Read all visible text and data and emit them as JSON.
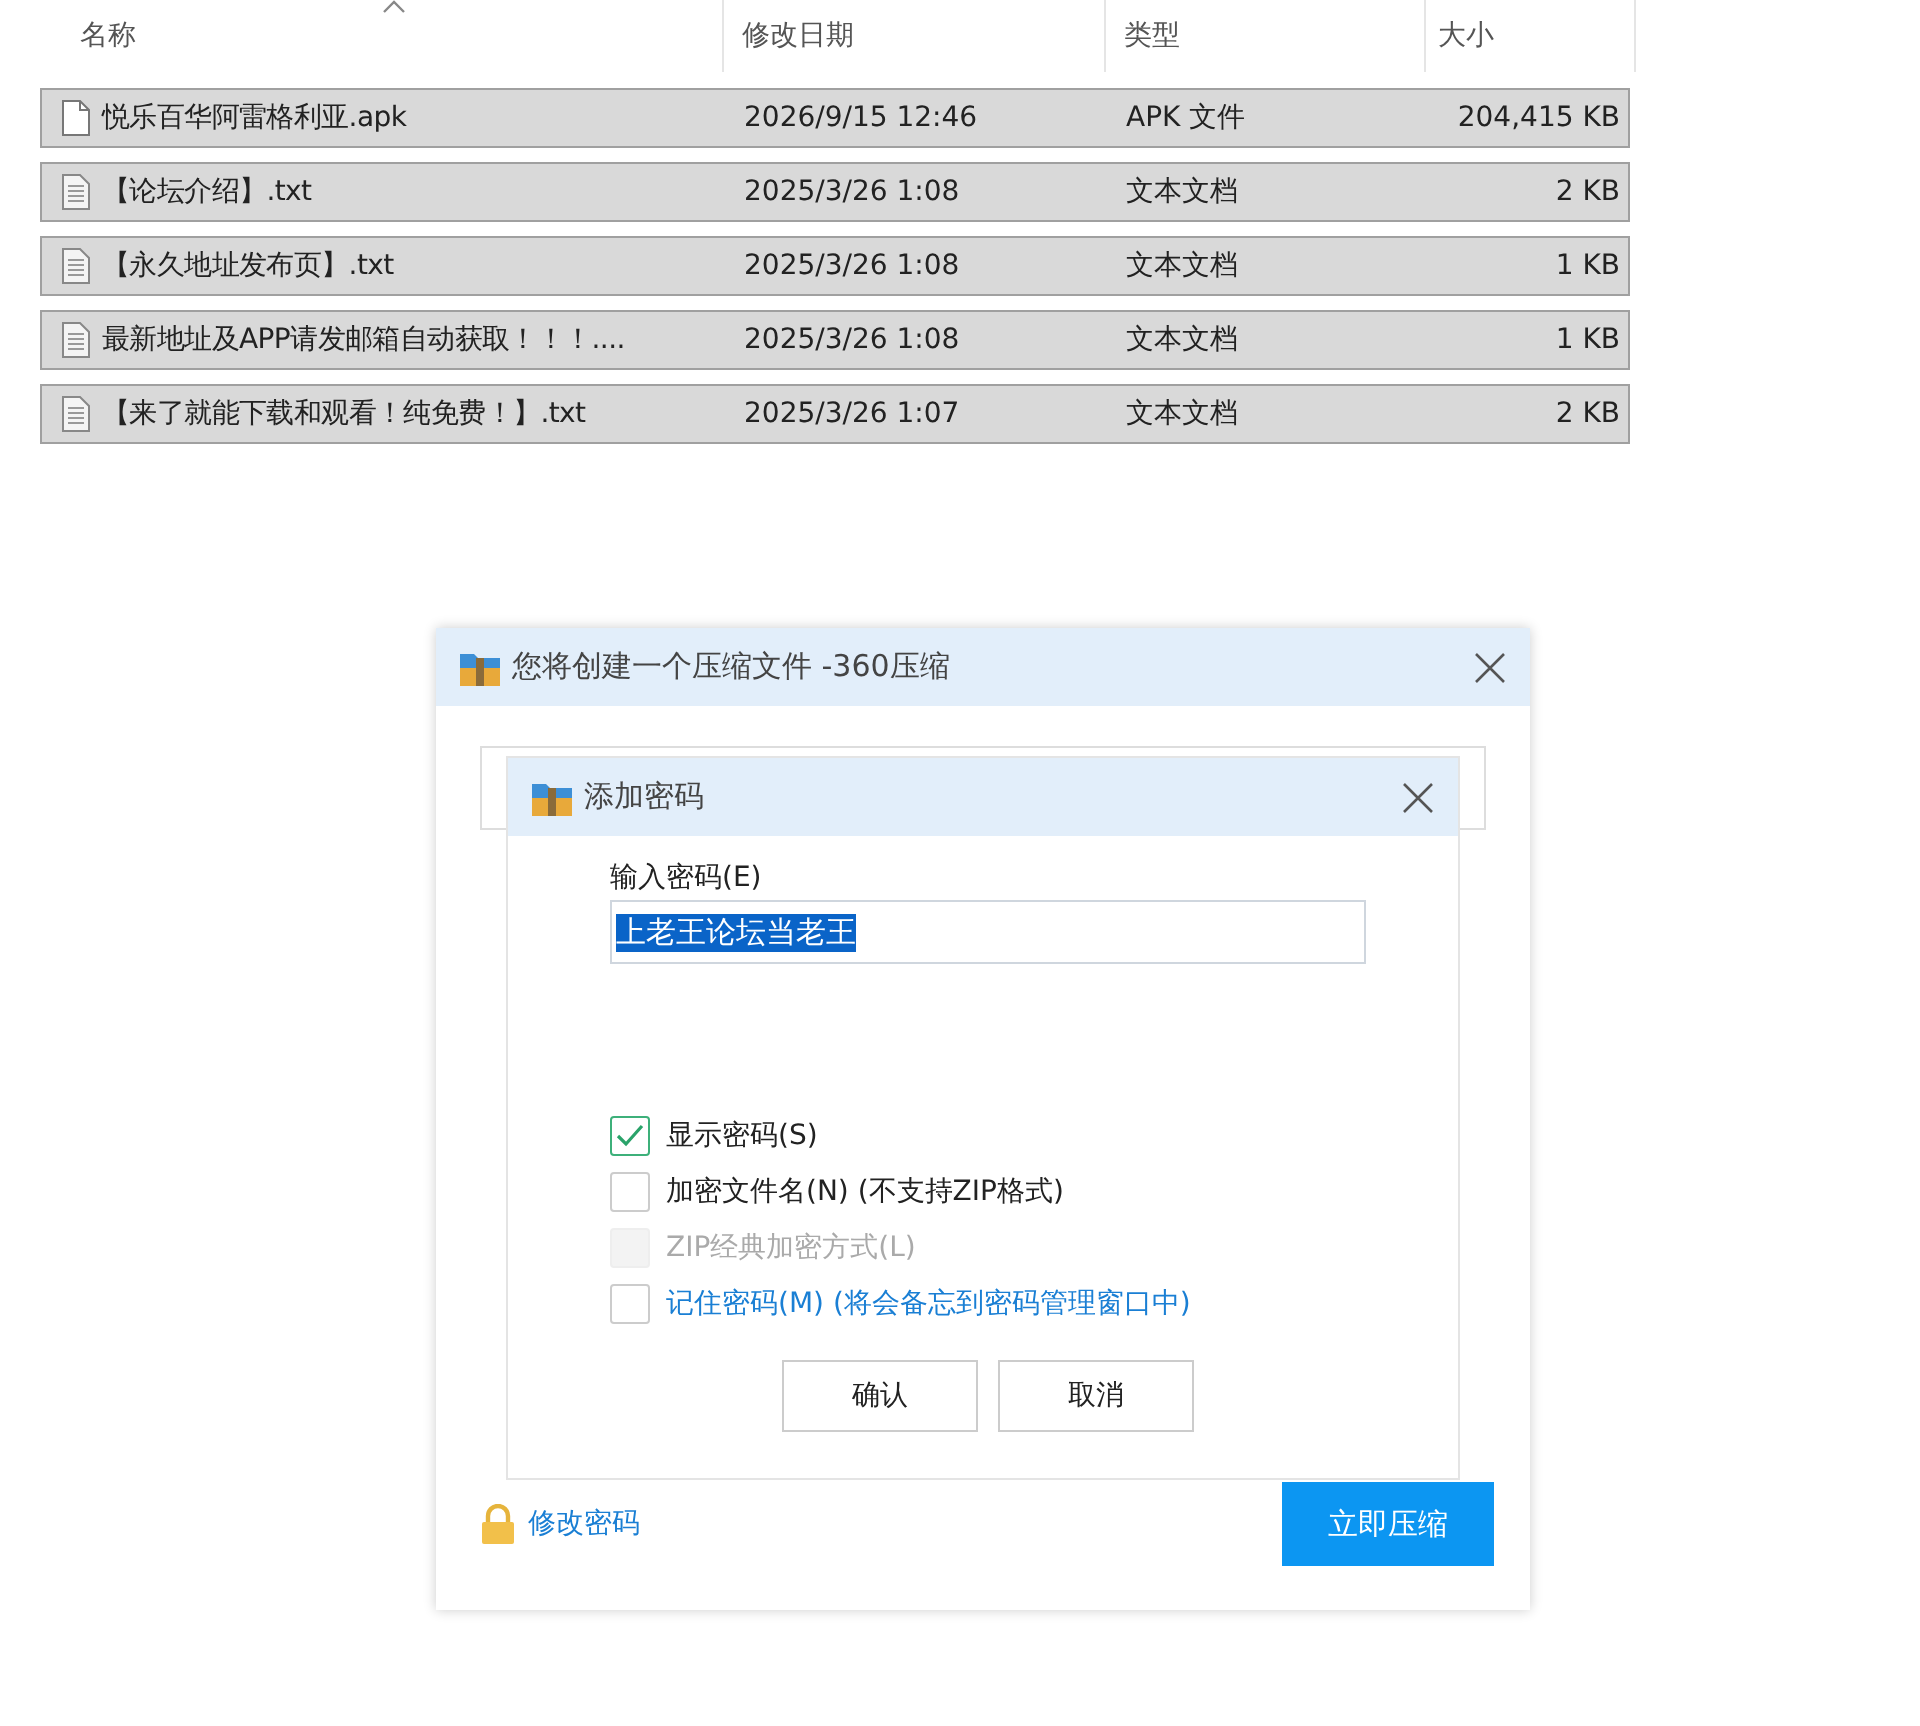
{
  "file_list": {
    "columns": [
      {
        "label": "名称",
        "sorted": true
      },
      {
        "label": "修改日期",
        "sorted": false
      },
      {
        "label": "类型",
        "sorted": false
      },
      {
        "label": "大小",
        "sorted": false
      }
    ],
    "rows": [
      {
        "kind": "blank",
        "name": "悦乐百华阿雷格利亚.apk",
        "modified": "2026/9/15 12:46",
        "type": "APK 文件",
        "size": "204,415 KB",
        "selected": true
      },
      {
        "kind": "text",
        "name": "【论坛介绍】.txt",
        "modified": "2025/3/26 1:08",
        "type": "文本文档",
        "size": "2 KB",
        "selected": true
      },
      {
        "kind": "text",
        "name": "【永久地址发布页】.txt",
        "modified": "2025/3/26 1:08",
        "type": "文本文档",
        "size": "1 KB",
        "selected": true
      },
      {
        "kind": "text",
        "name": "最新地址及APP请发邮箱自动获取！！！....",
        "modified": "2025/3/26 1:08",
        "type": "文本文档",
        "size": "1 KB",
        "selected": true
      },
      {
        "kind": "text",
        "name": "【来了就能下载和观看！纯免费！】.txt",
        "modified": "2025/3/26 1:07",
        "type": "文本文档",
        "size": "2 KB",
        "selected": true
      }
    ]
  },
  "compress_dialog": {
    "title": "您将创建一个压缩文件 -360压缩",
    "change_password_link": "修改密码",
    "compress_button": "立即压缩",
    "password_dialog": {
      "title": "添加密码",
      "password_label": "输入密码(E)",
      "password_value": "上老王论坛当老王",
      "options": [
        {
          "kind": "plain",
          "label": "显示密码(S)",
          "checked": true,
          "disabled": false
        },
        {
          "kind": "plain",
          "label": "加密文件名(N) (不支持ZIP格式)",
          "checked": false,
          "disabled": false
        },
        {
          "kind": "plain",
          "label": "ZIP经典加密方式(L)",
          "checked": false,
          "disabled": true
        },
        {
          "kind": "link",
          "label": "记住密码(M) (将会备忘到密码管理窗口中)",
          "checked": false,
          "disabled": false
        }
      ],
      "buttons": [
        "确认",
        "取消"
      ]
    }
  }
}
